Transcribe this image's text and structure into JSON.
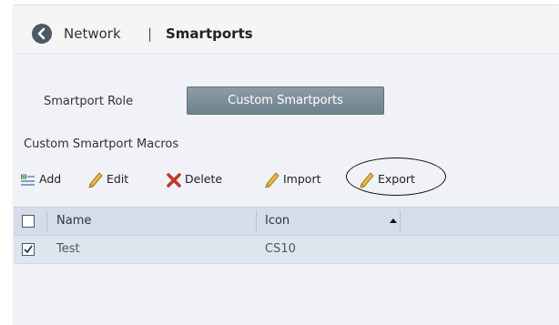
{
  "header": {
    "breadcrumb_parent": "Network",
    "separator": "|",
    "breadcrumb_current": "Smartports",
    "back_icon": "chevron-left-circle"
  },
  "tabs": [
    {
      "label": "Smartport Role",
      "active": false
    },
    {
      "label": "Custom Smartports",
      "active": true
    }
  ],
  "section": {
    "title": "Custom Smartport Macros"
  },
  "toolbar": {
    "add_label": "Add",
    "edit_label": "Edit",
    "delete_label": "Delete",
    "import_label": "Import",
    "export_label": "Export",
    "highlighted": "Export"
  },
  "table": {
    "columns": [
      "Name",
      "Icon"
    ],
    "sort_column": "Icon",
    "sort_direction": "ascending",
    "rows": [
      {
        "checked": true,
        "name": "Test",
        "icon": "CS10"
      }
    ]
  },
  "colors": {
    "accent": "#6f838c",
    "table_header": "#d4dde9",
    "delete_icon": "#c0392b",
    "pencil": "#d6a72b"
  }
}
